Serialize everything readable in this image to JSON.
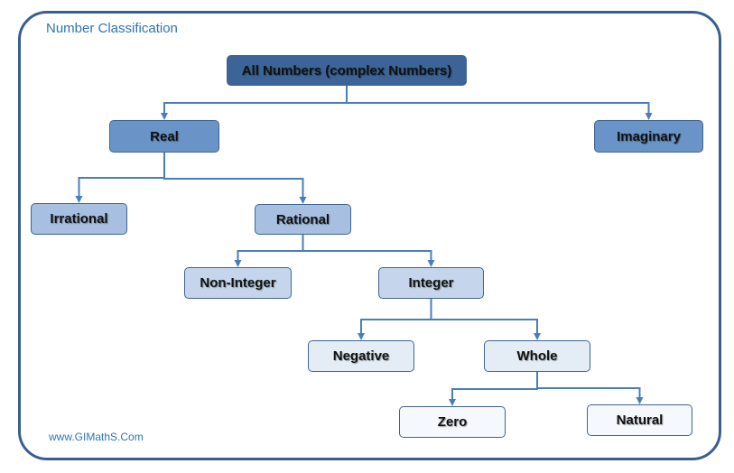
{
  "diagram": {
    "title": "Number Classification",
    "footer": "www.GIMathS.Com",
    "colors": {
      "frame": "#3a5f8f",
      "connector": "#4a7ebb",
      "title_text": "#2e74b5"
    },
    "nodes": {
      "all": "All Numbers (complex Numbers)",
      "real": "Real",
      "imaginary": "Imaginary",
      "irrational": "Irrational",
      "rational": "Rational",
      "non_integer": "Non-Integer",
      "integer": "Integer",
      "negative": "Negative",
      "whole": "Whole",
      "zero": "Zero",
      "natural": "Natural"
    },
    "edges": [
      [
        "all",
        "real"
      ],
      [
        "all",
        "imaginary"
      ],
      [
        "real",
        "irrational"
      ],
      [
        "real",
        "rational"
      ],
      [
        "rational",
        "non_integer"
      ],
      [
        "rational",
        "integer"
      ],
      [
        "integer",
        "negative"
      ],
      [
        "integer",
        "whole"
      ],
      [
        "whole",
        "zero"
      ],
      [
        "whole",
        "natural"
      ]
    ]
  }
}
